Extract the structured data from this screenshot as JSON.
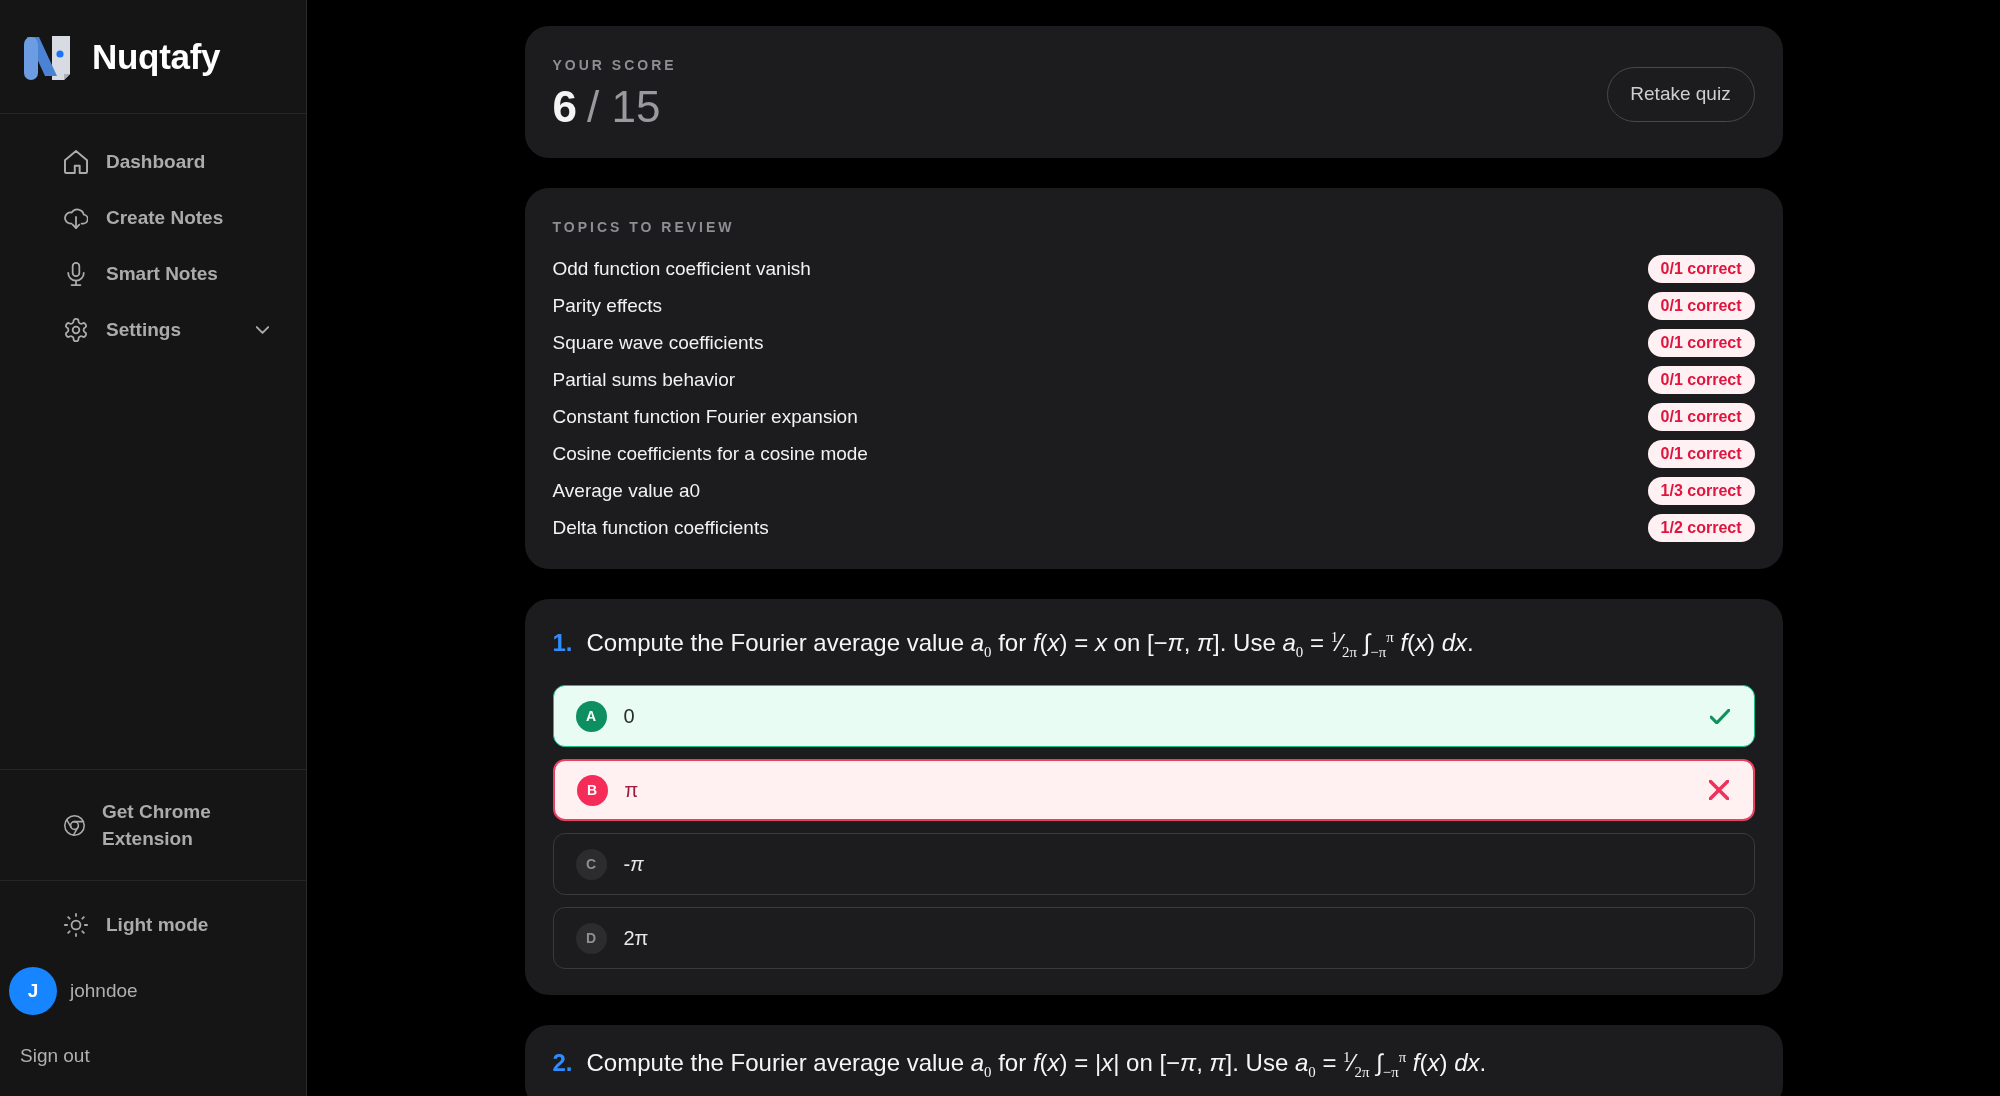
{
  "sidebar": {
    "brand": "Nuqtafy",
    "nav": [
      {
        "label": "Dashboard"
      },
      {
        "label": "Create Notes"
      },
      {
        "label": "Smart Notes"
      },
      {
        "label": "Settings",
        "expanded": false
      }
    ],
    "extension_link": "Get Chrome Extension",
    "theme_toggle": "Light mode",
    "user": {
      "initial": "J",
      "name": "johndoe"
    },
    "sign_out": "Sign out"
  },
  "score": {
    "label": "YOUR SCORE",
    "correct": "6",
    "separator": "/",
    "total": "15",
    "retake_button": "Retake quiz"
  },
  "topics": {
    "title": "TOPICS TO REVIEW",
    "items": [
      {
        "name": "Odd function coefficient vanish",
        "result": "0/1 correct"
      },
      {
        "name": "Parity effects",
        "result": "0/1 correct"
      },
      {
        "name": "Square wave coefficients",
        "result": "0/1 correct"
      },
      {
        "name": "Partial sums behavior",
        "result": "0/1 correct"
      },
      {
        "name": "Constant function Fourier expansion",
        "result": "0/1 correct"
      },
      {
        "name": "Cosine coefficients for a cosine mode",
        "result": "0/1 correct"
      },
      {
        "name": "Average value a0",
        "result": "1/3 correct"
      },
      {
        "name": "Delta function coefficients",
        "result": "1/2 correct"
      }
    ]
  },
  "questions": [
    {
      "number": "1.",
      "text": "Compute the Fourier average value *a*$_{0}$ for *f*(*x*) = *x* on [−*π*, *π*]. Use *a*$_{0}$ = $^{1}$⁄$_{2π}$ ∫$_{−π}$$^{π}$ *f*(*x*) *dx*.",
      "options": [
        {
          "letter": "A",
          "text": "0",
          "selected": false,
          "correct": true
        },
        {
          "letter": "B",
          "text": "π",
          "selected": true,
          "correct": false
        },
        {
          "letter": "C",
          "text": "-*π*",
          "selected": false,
          "correct": false
        },
        {
          "letter": "D",
          "text": "2π",
          "selected": false,
          "correct": false
        }
      ]
    },
    {
      "number": "2.",
      "text": "Compute the Fourier average value *a*$_{0}$ for *f*(*x*) = |*x*| on [−*π*, *π*]. Use *a*$_{0}$ = $^{1}$⁄$_{2π}$ ∫$_{−π}$$^{π}$ *f*(*x*) *dx*."
    }
  ]
}
